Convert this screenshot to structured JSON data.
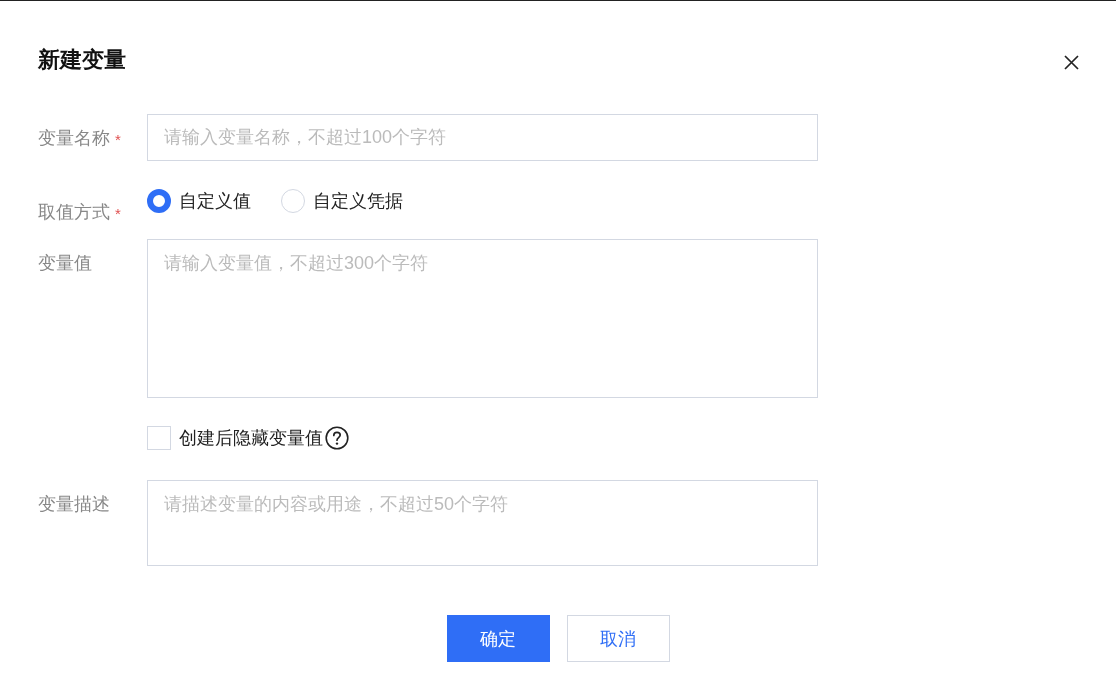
{
  "dialog": {
    "title": "新建变量"
  },
  "fields": [
    {
      "kind": "input",
      "label": "变量名称",
      "required_mark": "*",
      "placeholder": "请输入变量名称，不超过100个字符"
    },
    {
      "kind": "radio",
      "label": "取值方式",
      "required_mark": "*",
      "options": [
        {
          "label": "自定义值",
          "selected": true
        },
        {
          "label": "自定义凭据",
          "selected": false
        }
      ]
    },
    {
      "kind": "textarea",
      "label": "变量值",
      "placeholder": "请输入变量值，不超过300个字符"
    },
    {
      "kind": "checkbox",
      "text": "创建后隐藏变量值",
      "checked": false,
      "help": true
    },
    {
      "kind": "textarea",
      "label": "变量描述",
      "placeholder": "请描述变量的内容或用途，不超过50个字符"
    }
  ],
  "buttons": [
    {
      "label": "确定",
      "kind": "primary"
    },
    {
      "label": "取消",
      "kind": "secondary"
    }
  ]
}
